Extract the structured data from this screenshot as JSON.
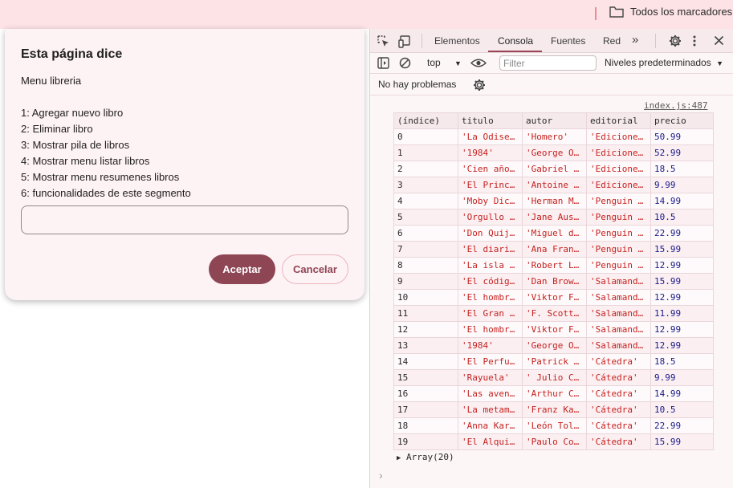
{
  "topbar": {
    "bookmarks_label": "Todos los marcadores",
    "folder_icon": "folder-icon"
  },
  "dialog": {
    "title": "Esta página dice",
    "message_lines": [
      "Menu libreria",
      "",
      "1: Agregar nuevo libro",
      "2: Eliminar libro",
      "3: Mostrar pila de libros",
      "4: Mostrar menu listar libros",
      "5: Mostrar menu resumenes libros",
      "6: funcionalidades de este segmento"
    ],
    "input_value": "",
    "ok_label": "Aceptar",
    "cancel_label": "Cancelar",
    "accent_color": "#8e4554"
  },
  "devtools": {
    "tabs": [
      "Elementos",
      "Consola",
      "Fuentes",
      "Red"
    ],
    "active_tab": "Consola",
    "more_tabs": "»",
    "context": "top",
    "filter_placeholder": "Filter",
    "levels": "Niveles predeterminados",
    "issues": "No hay problemas",
    "source_link": "index.js:487",
    "table": {
      "headers": [
        "(índice)",
        "titulo",
        "autor",
        "editorial",
        "precio"
      ],
      "rows": [
        [
          "0",
          "'La Odisea'",
          "'Homero'",
          "'Ediciones Clásicas'",
          "50.99"
        ],
        [
          "1",
          "'1984'",
          "'George Orwell'",
          "'Ediciones Clásicas'",
          "52.99"
        ],
        [
          "2",
          "'Cien años de soledad'",
          "'Gabriel García Márquez'",
          "'Ediciones Clásicas'",
          "18.5"
        ],
        [
          "3",
          "'El Principito'",
          "'Antoine de Saint-Exupéry'",
          "'Ediciones Clásicas'",
          "9.99"
        ],
        [
          "4",
          "'Moby Dick'",
          "'Herman Melville'",
          "'Penguin Clásicos'",
          "14.99"
        ],
        [
          "5",
          "'Orgullo y prejuicio'",
          "'Jane Austen'",
          "'Penguin Clásicos'",
          "10.5"
        ],
        [
          "6",
          "'Don Quijote'",
          "'Miguel de Cervantes'",
          "'Penguin Clásicos'",
          "22.99"
        ],
        [
          "7",
          "'El diario de Ana Frank'",
          "'Ana Frank'",
          "'Penguin Clásicos'",
          "15.99"
        ],
        [
          "8",
          "'La isla del tesoro'",
          "'Robert L. Stevenson'",
          "'Penguin Clásicos'",
          "12.99"
        ],
        [
          "9",
          "'El código Da Vinci'",
          "'Dan Brown'",
          "'Salamandra'",
          "15.99"
        ],
        [
          "10",
          "'El hombre en busca de sentido'",
          "'Viktor Frankl'",
          "'Salamandra'",
          "12.99"
        ],
        [
          "11",
          "'El Gran Gatsby'",
          "'F. Scott Fitzgerald'",
          "'Salamandra'",
          "11.99"
        ],
        [
          "12",
          "'El hombre en busca de sentido'",
          "'Viktor Frankl'",
          "'Salamandra'",
          "12.99"
        ],
        [
          "13",
          "'1984'",
          "'George Orwell'",
          "'Salamandra'",
          "12.99"
        ],
        [
          "14",
          "'El Perfume'",
          "'Patrick Süskind'",
          "'Cátedra'",
          "18.5"
        ],
        [
          "15",
          "'Rayuela'",
          "' Julio Cortázar'",
          "'Cátedra'",
          "9.99"
        ],
        [
          "16",
          "'Las aventuras de Sherlock Holmes'",
          "'Arthur Conan Doyle'",
          "'Cátedra'",
          "14.99"
        ],
        [
          "17",
          "'La metamorfosis'",
          "'Franz Kafka'",
          "'Cátedra'",
          "10.5"
        ],
        [
          "18",
          "'Anna Karenina'",
          "'León Tolstói'",
          "'Cátedra'",
          "22.99"
        ],
        [
          "19",
          "'El Alquimista'",
          "'Paulo Coelho'",
          "'Cátedra'",
          "15.99"
        ]
      ]
    },
    "array_summary": "Array(20)",
    "prompt_symbol": "›"
  }
}
